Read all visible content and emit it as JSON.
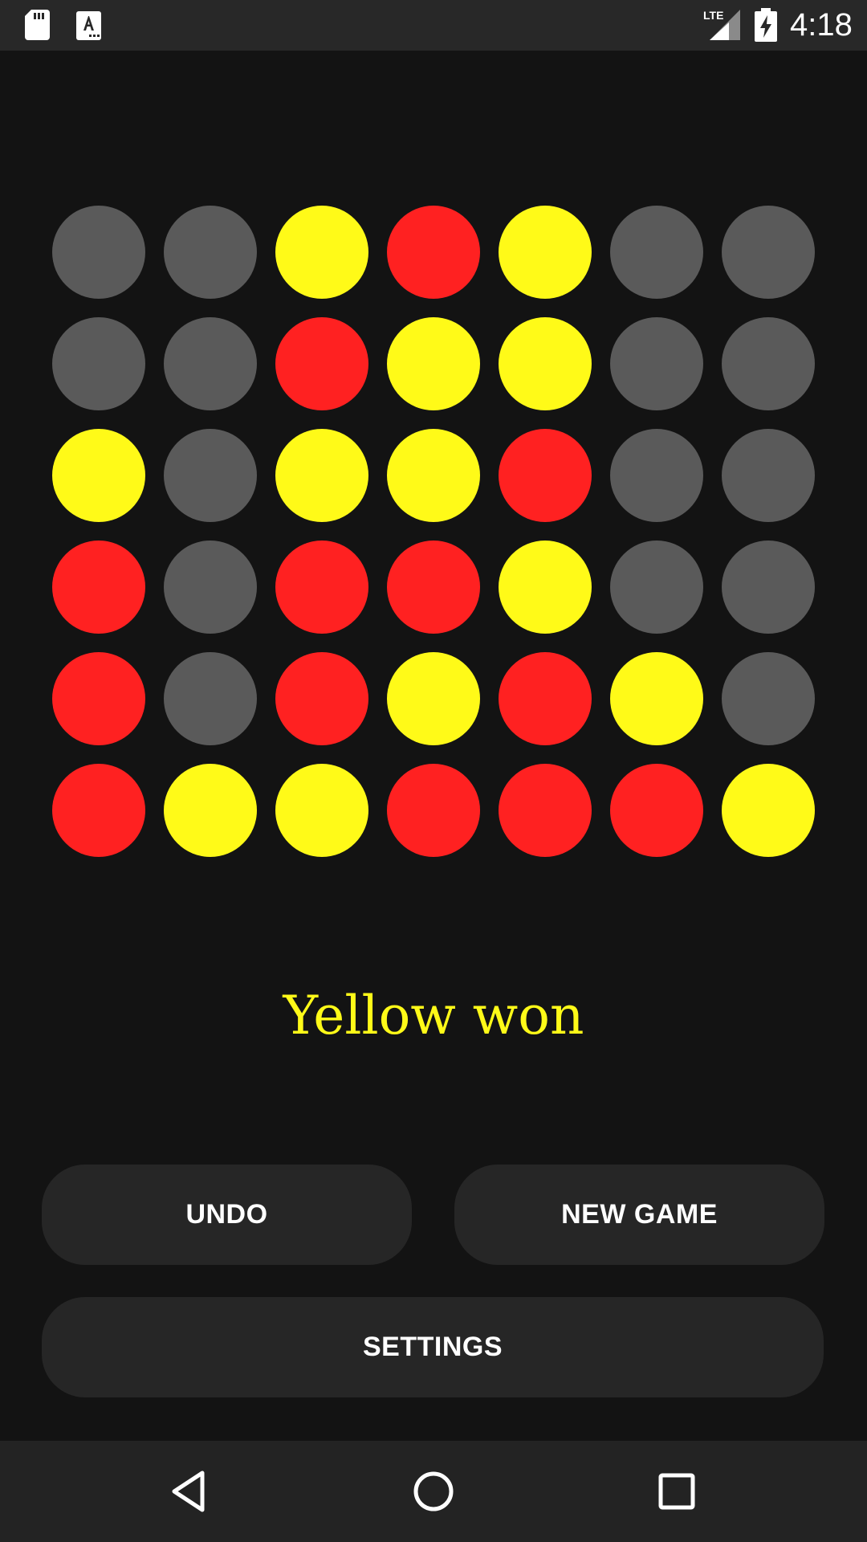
{
  "status_bar": {
    "time": "4:18",
    "icons": [
      "sd-card-icon",
      "text-a-icon",
      "lte-signal-icon",
      "battery-charging-icon"
    ],
    "network_label": "LTE"
  },
  "colors": {
    "background": "#131313",
    "empty": "#5a5a5a",
    "red": "#ff2121",
    "yellow": "#fffa18",
    "button": "#262626",
    "nav_bar": "#232323"
  },
  "board": {
    "rows": 6,
    "columns": 7,
    "cells": [
      [
        "empty",
        "empty",
        "yellow",
        "red",
        "yellow",
        "empty",
        "empty"
      ],
      [
        "empty",
        "empty",
        "red",
        "yellow",
        "yellow",
        "empty",
        "empty"
      ],
      [
        "yellow",
        "empty",
        "yellow",
        "yellow",
        "red",
        "empty",
        "empty"
      ],
      [
        "red",
        "empty",
        "red",
        "red",
        "yellow",
        "empty",
        "empty"
      ],
      [
        "red",
        "empty",
        "red",
        "yellow",
        "red",
        "yellow",
        "empty"
      ],
      [
        "red",
        "yellow",
        "yellow",
        "red",
        "red",
        "red",
        "yellow"
      ]
    ]
  },
  "status_message": {
    "text": "Yellow won",
    "color": "#fffa18"
  },
  "buttons": {
    "undo_label": "UNDO",
    "new_game_label": "NEW GAME",
    "settings_label": "SETTINGS"
  },
  "nav_bar": {
    "icons": [
      "back-icon",
      "home-icon",
      "recents-icon"
    ]
  }
}
